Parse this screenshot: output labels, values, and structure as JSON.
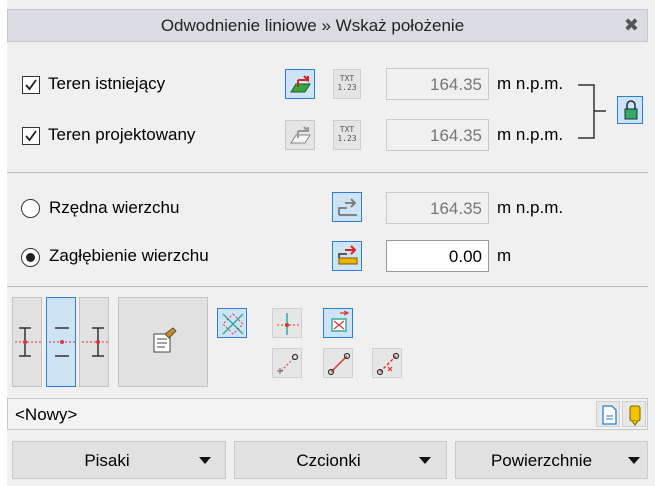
{
  "window": {
    "title": "Odwodnienie liniowe » Wskaż położenie",
    "close_glyph": "✖"
  },
  "terrain": {
    "existing": {
      "label": "Teren istniejący",
      "checked": true,
      "value": "164.35",
      "unit": "m n.p.m."
    },
    "designed": {
      "label": "Teren projektowany",
      "checked": true,
      "value": "164.35",
      "unit": "m n.p.m."
    },
    "txt_icon_text": [
      "TXT",
      "1.23"
    ]
  },
  "top_elevation": {
    "ordinate": {
      "label": "Rzędna wierzchu",
      "selected": false,
      "value": "164.35",
      "unit": "m n.p.m."
    },
    "depth": {
      "label": "Zagłębienie wierzchu",
      "selected": true,
      "value": "0.00",
      "unit": "m"
    }
  },
  "style_combo": {
    "value": "<Nowy>"
  },
  "bottom_buttons": [
    {
      "label": "Pisaki"
    },
    {
      "label": "Czcionki"
    },
    {
      "label": "Powierzchnie"
    }
  ],
  "colors": {
    "accent": "#2a7fd0",
    "active_bg": "#cfe3f6",
    "panel_bg": "#f0f0f0",
    "title_bg": "#d9dce1"
  }
}
